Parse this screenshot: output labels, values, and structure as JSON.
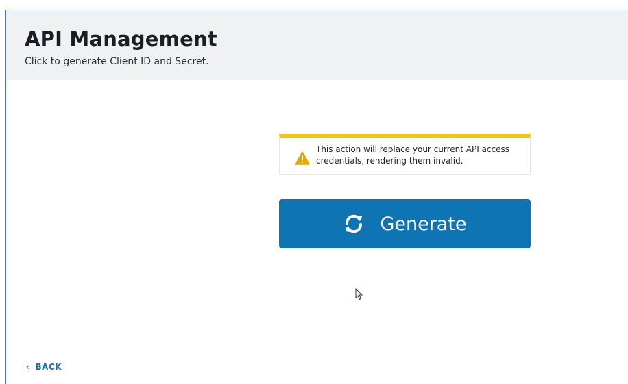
{
  "header": {
    "title": "API Management",
    "subtitle": "Click to generate Client ID and Secret."
  },
  "warning": {
    "icon": "warning-triangle-icon",
    "text": "This action will replace your current API access credentials, rendering them invalid.",
    "accent_color": "#f0c419"
  },
  "generate_button": {
    "label": "Generate",
    "icon": "sync-icon",
    "color": "#0e74b4"
  },
  "back_link": {
    "chevron": "‹",
    "label": "BACK"
  }
}
